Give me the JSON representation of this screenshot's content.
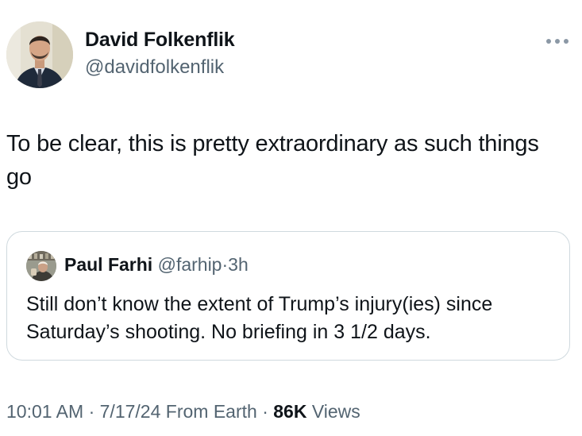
{
  "author": {
    "display_name": "David Folkenflik",
    "handle": "@davidfolkenflik"
  },
  "tweet": {
    "text": "To be clear, this is pretty extraordinary as such things go"
  },
  "quote": {
    "display_name": "Paul Farhi",
    "handle": "@farhip",
    "separator": "·",
    "time": "3h",
    "text": "Still don’t know the extent of Trump’s injury(ies) since Saturday’s shooting. No briefing in 3 1/2 days."
  },
  "meta": {
    "time": "10:01 AM",
    "separator1": "·",
    "date": "7/17/24",
    "source": "From Earth",
    "separator2": "·",
    "views_count": "86K",
    "views_label": "Views"
  },
  "icons": {
    "more": "more-horizontal-icon"
  },
  "colors": {
    "primary_text": "#0f1419",
    "secondary_text": "#536471",
    "border": "#cfd9de"
  }
}
